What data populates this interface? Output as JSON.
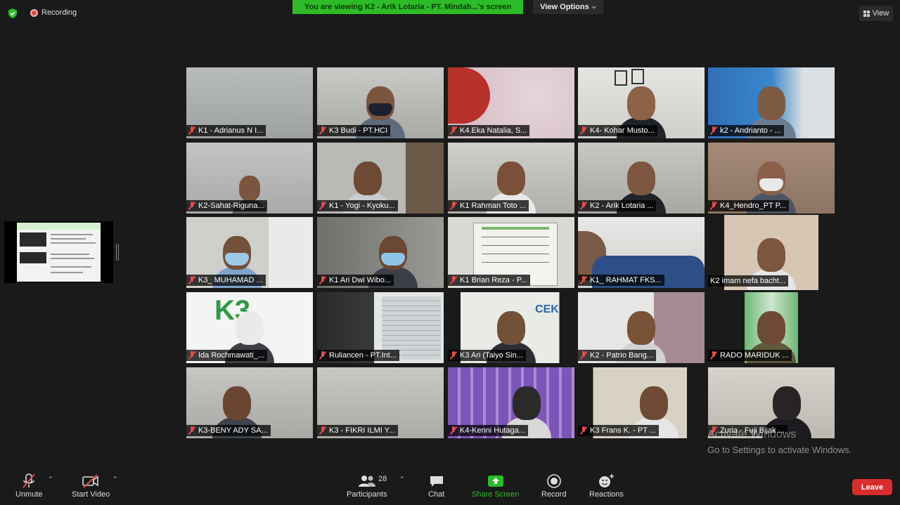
{
  "topbar": {
    "recording_label": "Recording",
    "viewing_banner": "You are viewing K2 - Arik Lotaria - PT. Mindah...'s screen",
    "view_options_label": "View Options",
    "view_label": "View"
  },
  "participants": [
    {
      "name": "K1 - Adrianus N I..."
    },
    {
      "name": "K3 Budi - PT.HCI"
    },
    {
      "name": "K4.Eka Natalia, S..."
    },
    {
      "name": "K4- Kohar Musto..."
    },
    {
      "name": "k2 - Andrianto - ..."
    },
    {
      "name": "K2-Sahat-Riguna..."
    },
    {
      "name": "K1 - Yogi - Kyoku..."
    },
    {
      "name": "K1 Rahman Toto ..."
    },
    {
      "name": "K2 - Arik Lotaria ..."
    },
    {
      "name": "K4_Hendro_PT P..."
    },
    {
      "name": "K3_ MUHAMAD ..."
    },
    {
      "name": "K1 Ari Dwi Wibo..."
    },
    {
      "name": "K1 Brian Reza - P..."
    },
    {
      "name": "K1_ RAHMAT FKS..."
    },
    {
      "name": "K2 imam nefa bacht..."
    },
    {
      "name": "Ida Rochmawati_..."
    },
    {
      "name": "Ruliancen - PT.Int..."
    },
    {
      "name": "K3 Ari (Taiyo Sin..."
    },
    {
      "name": "K2 - Patrio Bang..."
    },
    {
      "name": "RADO MARIDUK ..."
    },
    {
      "name": "K3-BENY ADY SA..."
    },
    {
      "name": "K3 - FIKRI ILMI Y..."
    },
    {
      "name": "K4-Kenni Hutaga..."
    },
    {
      "name": "K3 Frans K. - PT ..."
    },
    {
      "name": "Zuria - Fuji Bijak ..."
    }
  ],
  "watermark": {
    "line1": "Activate Windows",
    "line2": "Go to Settings to activate Windows."
  },
  "toolbar": {
    "unmute": "Unmute",
    "start_video": "Start Video",
    "participants": "Participants",
    "participants_count": "28",
    "chat": "Chat",
    "share_screen": "Share Screen",
    "record": "Record",
    "reactions": "Reactions",
    "leave": "Leave"
  }
}
